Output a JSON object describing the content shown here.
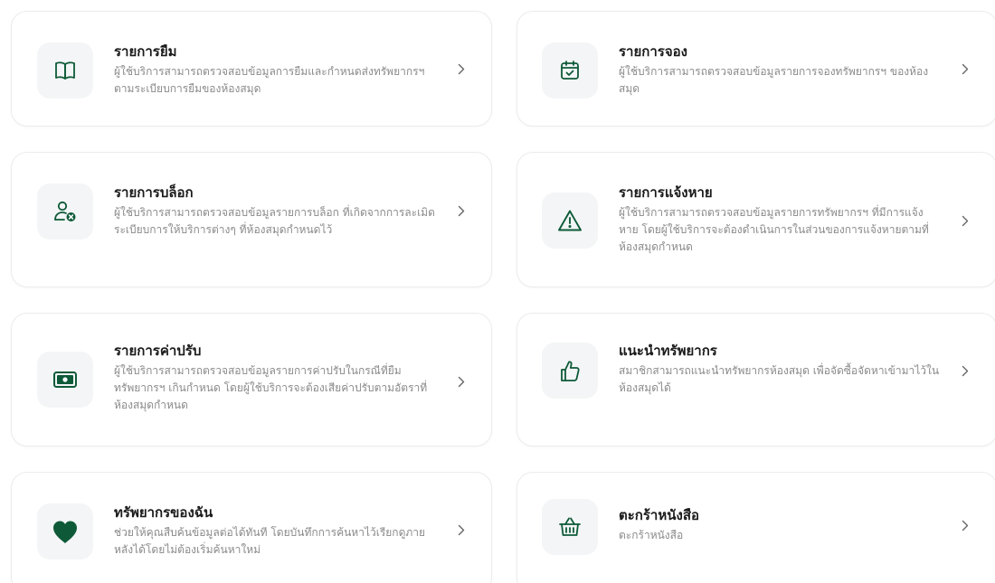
{
  "theme": {
    "accent": "#0e5a38",
    "title_color": "#1a1a1a",
    "desc_color": "#8a8a8a",
    "icon_bg": "#f3f5f6"
  },
  "cards": [
    {
      "title": "รายการยืม",
      "description": "ผู้ใช้บริการสามารถตรวจสอบข้อมูลการยืมและกำหนดส่งทรัพยากรฯ ตามระเบียบการยืมของห้องสมุด",
      "icon": "open-book-icon"
    },
    {
      "title": "รายการจอง",
      "description": "ผู้ใช้บริการสามารถตรวจสอบข้อมูลรายการจองทรัพยากรฯ ของห้องสมุด",
      "icon": "calendar-check-icon"
    },
    {
      "title": "รายการบล็อก",
      "description": "ผู้ใช้บริการสามารถตรวจสอบข้อมูลรายการบล็อก ที่เกิดจากการละเมิดระเบียบการให้บริการต่างๆ ที่ห้องสมุดกำหนดไว้",
      "icon": "user-blocked-icon"
    },
    {
      "title": "รายการแจ้งหาย",
      "description": "ผู้ใช้บริการสามารถตรวจสอบข้อมูลรายการทรัพยากรฯ ที่มีการแจ้งหาย โดยผู้ใช้บริการจะต้องดำเนินการในส่วนของการแจ้งหายตามที่ห้องสมุดกำหนด",
      "icon": "warning-triangle-icon"
    },
    {
      "title": "รายการค่าปรับ",
      "description": "ผู้ใช้บริการสามารถตรวจสอบข้อมูลรายการค่าปรับในกรณีที่ยืมทรัพยากรฯ เกินกำหนด โดยผู้ใช้บริการจะต้องเสียค่าปรับตามอัตราที่ห้องสมุดกำหนด",
      "icon": "money-bill-icon"
    },
    {
      "title": "แนะนำทรัพยากร",
      "description": "สมาชิกสามารถแนะนำทรัพยากรห้องสมุด เพื่อจัดซื้อจัดหาเข้ามาไว้ในห้องสมุดได้",
      "icon": "thumbs-up-icon"
    },
    {
      "title": "ทรัพยากรของฉัน",
      "description": "ช่วยให้คุณสืบค้นข้อมูลต่อได้ทันที โดยบันทึกการค้นหาไว้เรียกดูภายหลังได้โดยไม่ต้องเริ่มค้นหาใหม่",
      "icon": "heart-icon"
    },
    {
      "title": "ตะกร้าหนังสือ",
      "description": "ตะกร้าหนังสือ",
      "icon": "basket-icon"
    }
  ]
}
